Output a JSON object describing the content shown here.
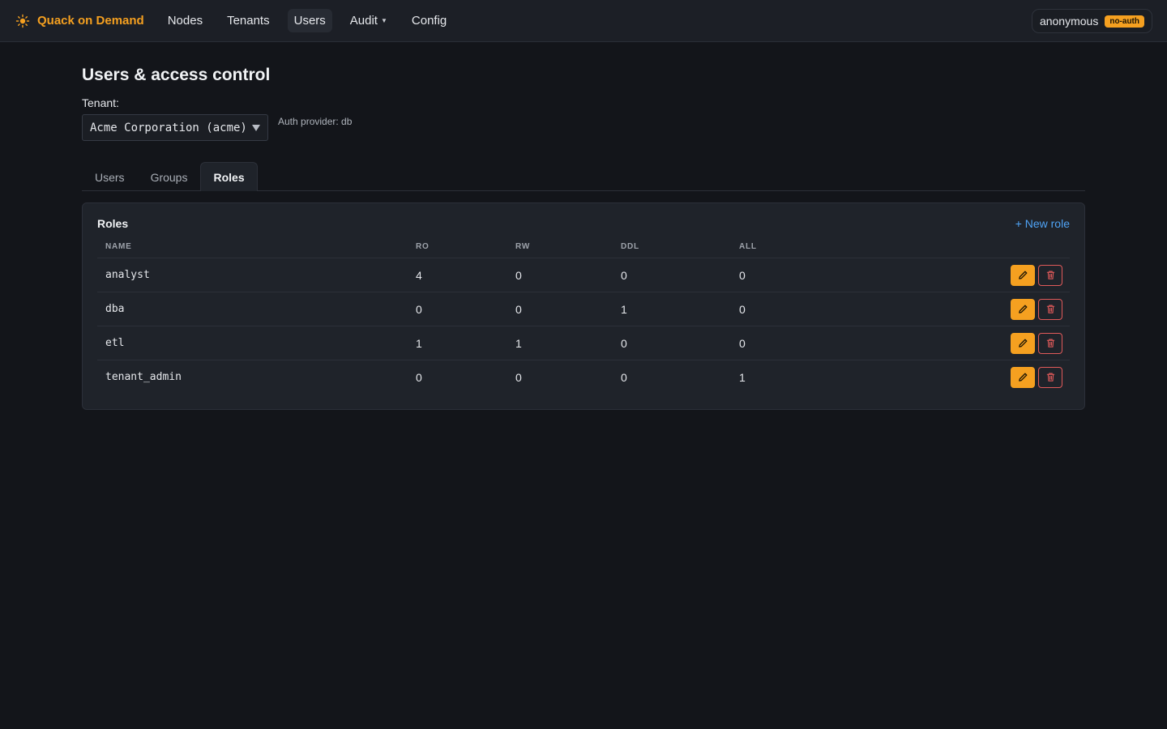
{
  "nav": {
    "brand": "Quack on Demand",
    "items": [
      {
        "label": "Nodes",
        "active": false
      },
      {
        "label": "Tenants",
        "active": false
      },
      {
        "label": "Users",
        "active": true
      },
      {
        "label": "Audit",
        "active": false,
        "dropdown": true
      },
      {
        "label": "Config",
        "active": false
      }
    ],
    "user": "anonymous",
    "user_badge": "no-auth"
  },
  "page": {
    "title": "Users & access control",
    "tenant_label": "Tenant:",
    "tenant_selected": "Acme Corporation (acme)",
    "auth_provider": "Auth provider: db"
  },
  "tabs": [
    {
      "label": "Users",
      "active": false
    },
    {
      "label": "Groups",
      "active": false
    },
    {
      "label": "Roles",
      "active": true
    }
  ],
  "roles": {
    "title": "Roles",
    "new_label": "+ New role",
    "columns": [
      "NAME",
      "RO",
      "RW",
      "DDL",
      "ALL"
    ],
    "rows": [
      {
        "name": "analyst",
        "ro": "4",
        "rw": "0",
        "ddl": "0",
        "all": "0"
      },
      {
        "name": "dba",
        "ro": "0",
        "rw": "0",
        "ddl": "1",
        "all": "0"
      },
      {
        "name": "etl",
        "ro": "1",
        "rw": "1",
        "ddl": "0",
        "all": "0"
      },
      {
        "name": "tenant_admin",
        "ro": "0",
        "rw": "0",
        "ddl": "0",
        "all": "1"
      }
    ]
  },
  "colors": {
    "accent": "#f5a020",
    "link": "#4fa3f5",
    "danger": "#e05a5a",
    "background": "#13151a"
  },
  "icons": [
    "logo-icon",
    "pencil-icon",
    "trash-icon",
    "chevron-down-icon"
  ]
}
